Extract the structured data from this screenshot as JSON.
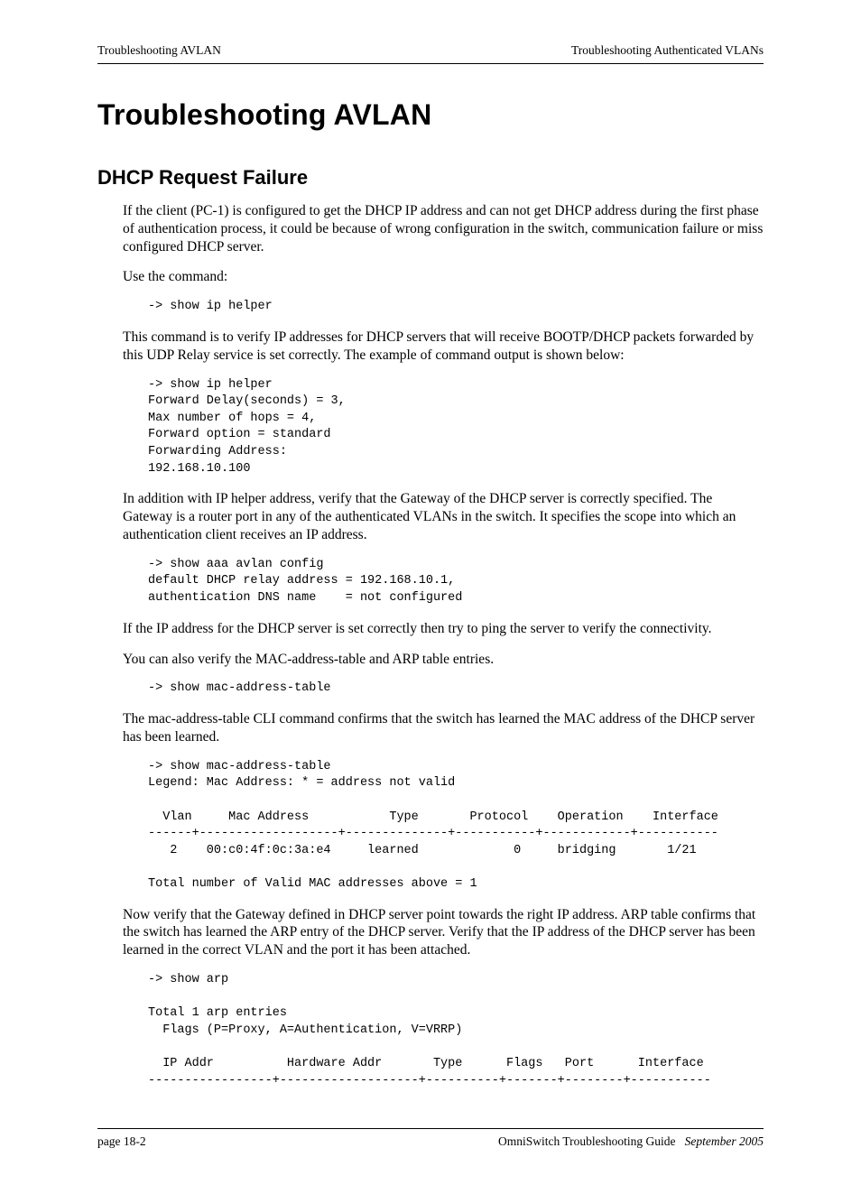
{
  "header": {
    "left": "Troubleshooting AVLAN",
    "right": "Troubleshooting Authenticated VLANs"
  },
  "title": "Troubleshooting AVLAN",
  "subtitle": "DHCP Request Failure",
  "p1": "If the client (PC-1) is configured to get the DHCP IP address and can not get DHCP address during the first phase of authentication process, it could be because of wrong configuration in the switch, communication failure or miss configured DHCP server.",
  "p2": "Use the command:",
  "code1": "-> show ip helper",
  "p3": "This command is to verify IP addresses for DHCP servers that will receive BOOTP/DHCP packets forwarded by this UDP Relay service is set correctly. The example of command output is shown below:",
  "code2": "-> show ip helper\nForward Delay(seconds) = 3,\nMax number of hops = 4,\nForward option = standard\nForwarding Address:\n192.168.10.100",
  "p4": "In addition with IP helper address, verify that the Gateway of the DHCP server is correctly specified. The Gateway is a router port in any of the authenticated VLANs in the switch. It specifies the scope into which an authentication client receives an IP address.",
  "code3": "-> show aaa avlan config\ndefault DHCP relay address = 192.168.10.1,\nauthentication DNS name    = not configured",
  "p5": "If the IP address for the DHCP server is set correctly then try to ping the server to verify the connectivity.",
  "p6": "You can also verify the MAC-address-table and ARP table entries.",
  "code4": "-> show mac-address-table",
  "p7": "The mac-address-table CLI command confirms that the switch has learned the MAC address of the DHCP server has been learned.",
  "code5": "-> show mac-address-table\nLegend: Mac Address: * = address not valid\n\n  Vlan     Mac Address           Type       Protocol    Operation    Interface\n------+-------------------+--------------+-----------+------------+-----------\n   2    00:c0:4f:0c:3a:e4     learned             0     bridging       1/21\n\nTotal number of Valid MAC addresses above = 1",
  "p8": "Now verify that the Gateway defined in DHCP server point towards the right IP address. ARP table confirms that the switch has learned the ARP entry of the DHCP server. Verify that the IP address of the DHCP server has been learned in the correct VLAN and the port it has been attached.",
  "code6": "-> show arp\n\nTotal 1 arp entries\n  Flags (P=Proxy, A=Authentication, V=VRRP)\n\n  IP Addr          Hardware Addr       Type      Flags   Port      Interface\n-----------------+-------------------+----------+-------+--------+-----------",
  "footer": {
    "left": "page 18-2",
    "right_plain": "OmniSwitch Troubleshooting Guide",
    "right_italic": "September 2005"
  }
}
